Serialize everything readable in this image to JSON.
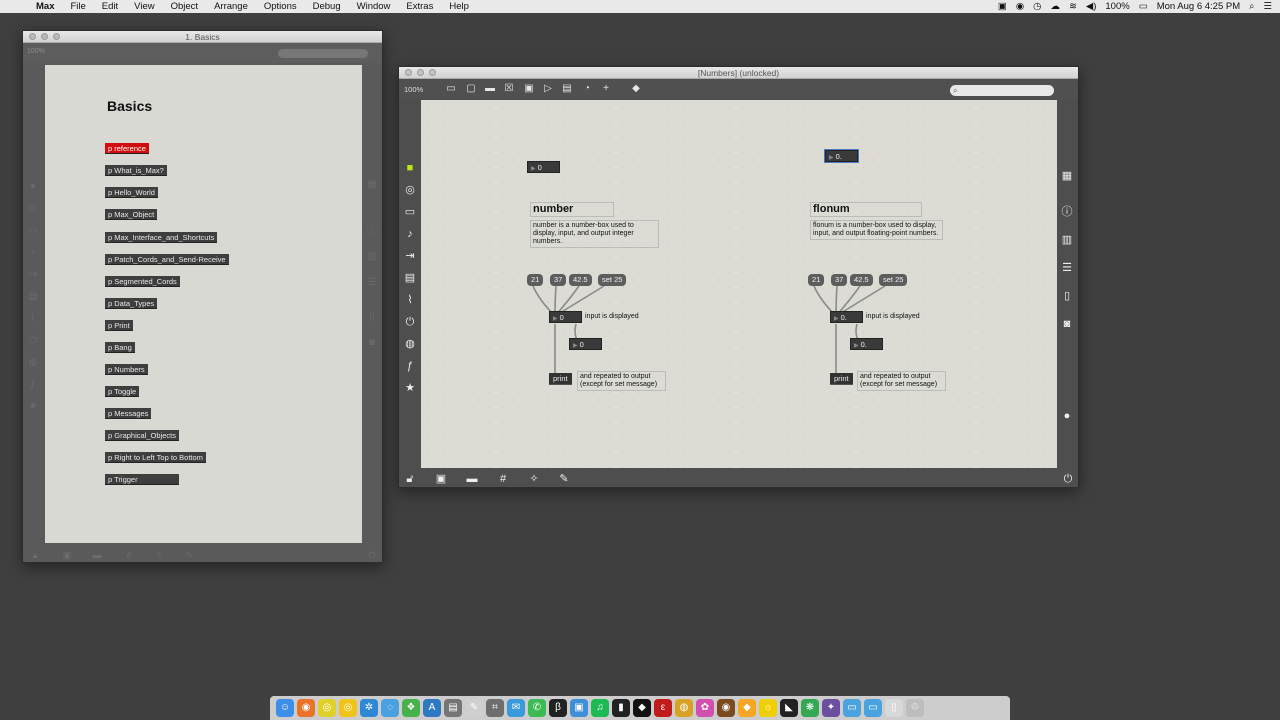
{
  "menubar": {
    "app": "Max",
    "items": [
      "File",
      "Edit",
      "View",
      "Object",
      "Arrange",
      "Options",
      "Debug",
      "Window",
      "Extras",
      "Help"
    ],
    "battery": "100%",
    "clock": "Mon Aug 6  4:25 PM"
  },
  "basics_window": {
    "title": "1. Basics",
    "zoom": "100%",
    "heading": "Basics",
    "subpatches": [
      "p reference",
      "p What_is_Max?",
      "p Hello_World",
      "p Max_Object",
      "p Max_Interface_and_Shortcuts",
      "p Patch_Cords_and_Send-Receive",
      "p Segmented_Cords",
      "p Data_Types",
      "p Print",
      "p Bang",
      "p Numbers",
      "p Toggle",
      "p Messages",
      "p Graphical_Objects",
      "p Right to Left Top to Bottom",
      "p Trigger"
    ]
  },
  "numbers_window": {
    "title": "[Numbers] (unlocked)",
    "zoom": "100%",
    "number": {
      "top_numbox": "0",
      "header": "number",
      "description": "number is a number-box used to display, input, and output integer numbers.",
      "messages": [
        "21",
        "37",
        "42.5",
        "set 25"
      ],
      "display_numbox": "0",
      "display_comment": "input is displayed",
      "out_numbox": "0",
      "print_object": "print",
      "print_comment": "and repeated to output (except for set message)"
    },
    "flonum": {
      "top_numbox": "0.",
      "header": "flonum",
      "description": "flonum is a number-box used to display, input, and output floating-point numbers.",
      "messages": [
        "21",
        "37",
        "42.5",
        "set 25"
      ],
      "display_numbox": "0.",
      "display_comment": "input is displayed",
      "out_numbox": "0.",
      "print_object": "print",
      "print_comment": "and repeated to output (except for set message)"
    }
  },
  "colors": {
    "patch_bg": "#dcdcd4",
    "selected_subpatch": "#d30d0d",
    "object_bg": "#333333",
    "selection_outline": "#4a78c8"
  }
}
